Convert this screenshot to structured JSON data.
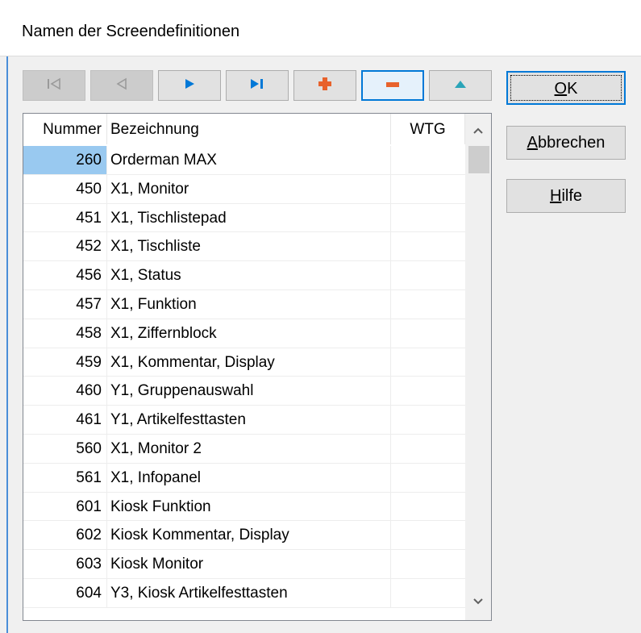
{
  "window": {
    "title": "Namen der Screendefinitionen"
  },
  "toolbar": {
    "buttons": [
      {
        "name": "first-record-button",
        "icon": "first-record-icon",
        "enabled": false
      },
      {
        "name": "prior-record-button",
        "icon": "prior-record-icon",
        "enabled": false
      },
      {
        "name": "next-record-button",
        "icon": "next-record-icon",
        "enabled": true
      },
      {
        "name": "last-record-button",
        "icon": "last-record-icon",
        "enabled": true
      },
      {
        "name": "insert-record-button",
        "icon": "plus-icon",
        "enabled": true
      },
      {
        "name": "delete-record-button",
        "icon": "minus-icon",
        "enabled": true
      },
      {
        "name": "edit-record-button",
        "icon": "triangle-up-icon",
        "enabled": true
      }
    ]
  },
  "grid": {
    "columns": {
      "nummer": "Nummer",
      "bezeichnung": "Bezeichnung",
      "wtg": "WTG"
    },
    "rows": [
      {
        "nummer": "260",
        "bezeichnung": "Orderman MAX",
        "wtg": ""
      },
      {
        "nummer": "450",
        "bezeichnung": "X1, Monitor",
        "wtg": ""
      },
      {
        "nummer": "451",
        "bezeichnung": "X1, Tischlistepad",
        "wtg": ""
      },
      {
        "nummer": "452",
        "bezeichnung": "X1, Tischliste",
        "wtg": ""
      },
      {
        "nummer": "456",
        "bezeichnung": "X1, Status",
        "wtg": ""
      },
      {
        "nummer": "457",
        "bezeichnung": "X1, Funktion",
        "wtg": ""
      },
      {
        "nummer": "458",
        "bezeichnung": "X1, Ziffernblock",
        "wtg": ""
      },
      {
        "nummer": "459",
        "bezeichnung": "X1, Kommentar, Display",
        "wtg": ""
      },
      {
        "nummer": "460",
        "bezeichnung": "Y1, Gruppenauswahl",
        "wtg": ""
      },
      {
        "nummer": "461",
        "bezeichnung": "Y1, Artikelfesttasten",
        "wtg": ""
      },
      {
        "nummer": "560",
        "bezeichnung": "X1, Monitor 2",
        "wtg": ""
      },
      {
        "nummer": "561",
        "bezeichnung": "X1, Infopanel",
        "wtg": ""
      },
      {
        "nummer": "601",
        "bezeichnung": "Kiosk Funktion",
        "wtg": ""
      },
      {
        "nummer": "602",
        "bezeichnung": "Kiosk Kommentar, Display",
        "wtg": ""
      },
      {
        "nummer": "603",
        "bezeichnung": "Kiosk Monitor",
        "wtg": ""
      },
      {
        "nummer": "604",
        "bezeichnung": "Y3, Kiosk Artikelfesttasten",
        "wtg": ""
      }
    ],
    "selected_index": 0
  },
  "buttons": {
    "ok": {
      "pre": "",
      "accel": "O",
      "post": "K"
    },
    "cancel": {
      "pre": "",
      "accel": "A",
      "post": "bbrechen"
    },
    "help": {
      "pre": "",
      "accel": "H",
      "post": "ilfe"
    }
  },
  "colors": {
    "accent": "#0078d7",
    "selection": "#99c9f0",
    "plus": "#e8622c",
    "minus": "#e8622c",
    "arrow": "#0078d7",
    "triangle": "#2aa4b8"
  }
}
